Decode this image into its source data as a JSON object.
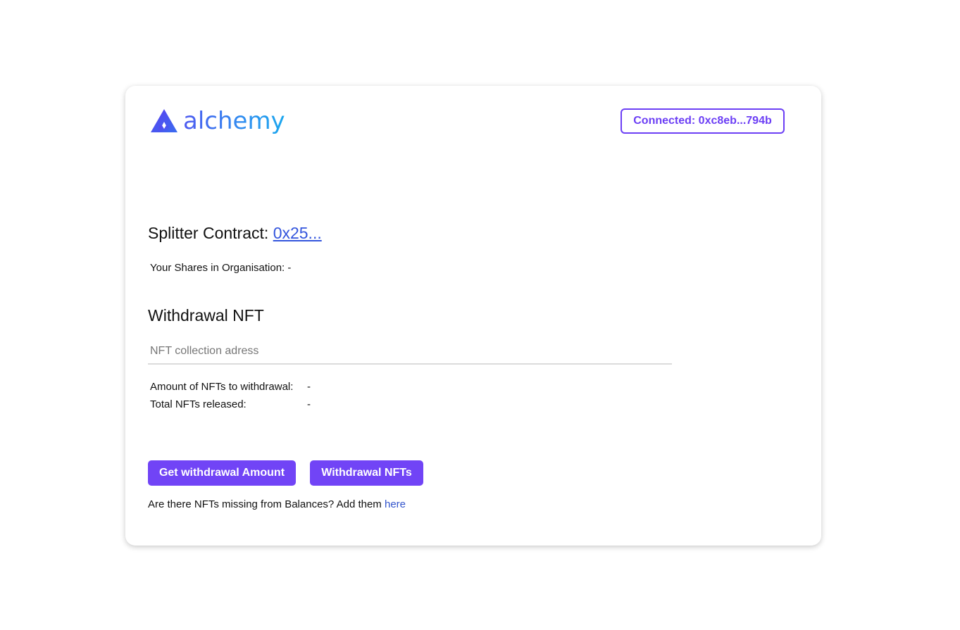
{
  "brand": {
    "name": "alchemy",
    "gradient_start": "#4f5af0",
    "gradient_end": "#1aa7ee"
  },
  "wallet": {
    "button_label": "Connected: 0xc8eb...794b",
    "accent": "#6c3ff5"
  },
  "splitter": {
    "label": "Splitter Contract:",
    "address_link": "0x25..."
  },
  "shares": {
    "text": "Your Shares in Organisation: -"
  },
  "withdrawal": {
    "title": "Withdrawal NFT",
    "input_placeholder": "NFT collection adress",
    "input_value": "",
    "amount_label": "Amount of NFTs to withdrawal:",
    "amount_value": "-",
    "released_label": "Total NFTs released:",
    "released_value": "-"
  },
  "actions": {
    "get_amount_label": "Get withdrawal Amount",
    "withdraw_label": "Withdrawal NFTs",
    "button_color": "#7144f6"
  },
  "footer_note": {
    "text": "Are there NFTs missing from Balances? Add them",
    "link_label": "here"
  }
}
